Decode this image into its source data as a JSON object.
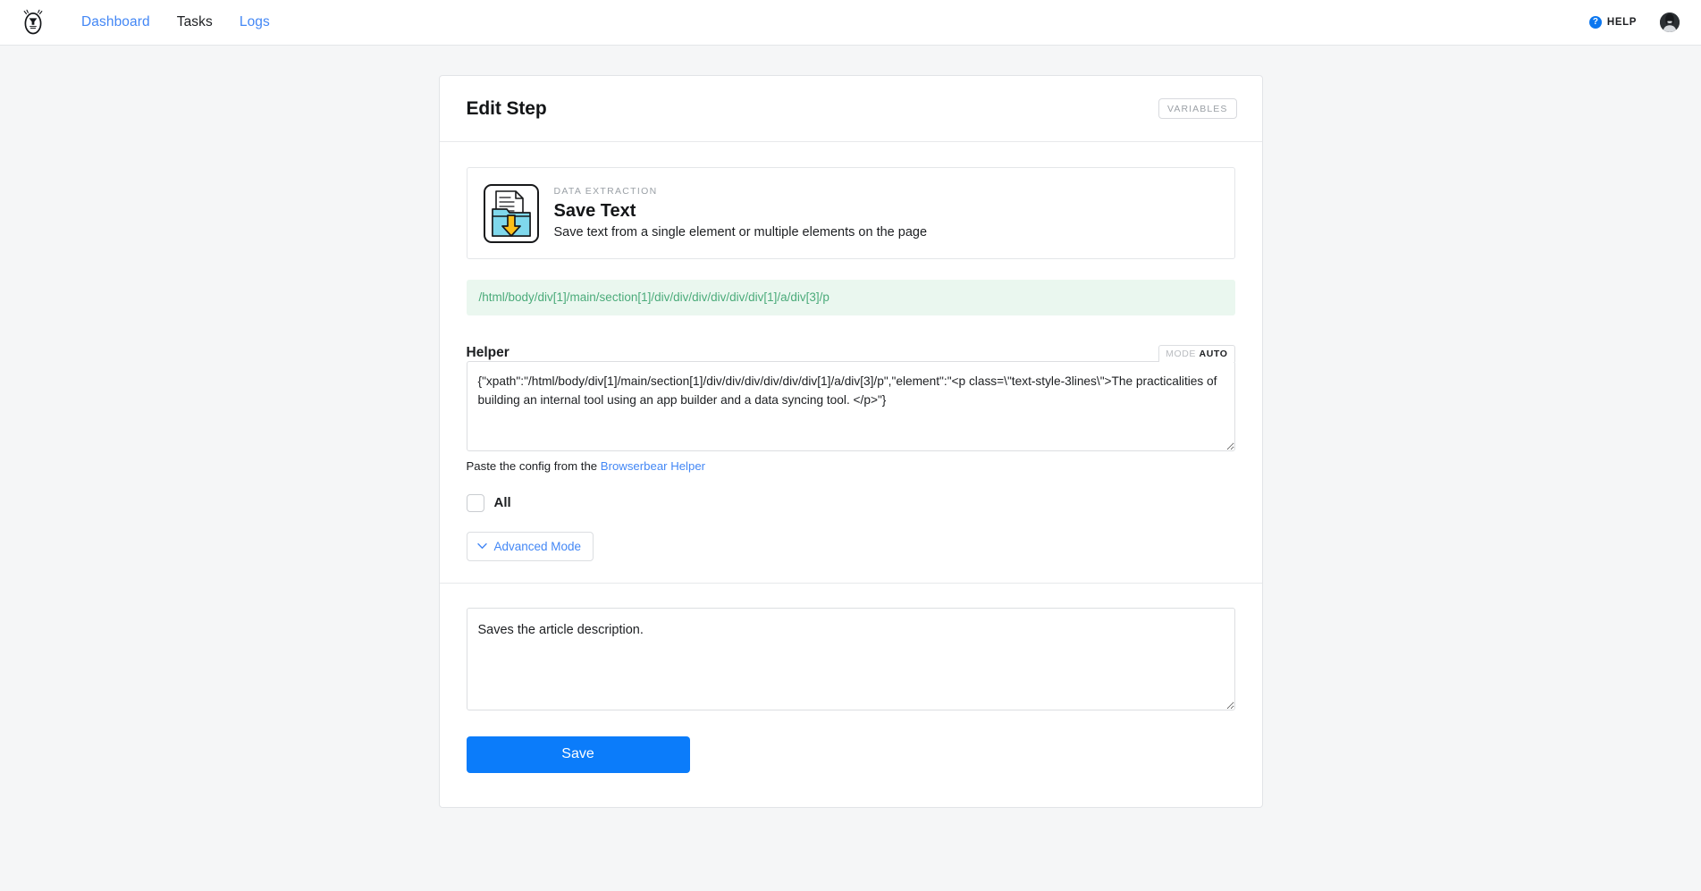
{
  "navbar": {
    "brand_icon": "bear-logo-icon",
    "links": [
      {
        "label": "Dashboard",
        "active": false
      },
      {
        "label": "Tasks",
        "active": true
      },
      {
        "label": "Logs",
        "active": false
      }
    ],
    "help": {
      "icon": "question-mark-circle-icon",
      "glyph": "?",
      "label": "HELP"
    },
    "avatar": {
      "icon": "user-avatar-icon"
    }
  },
  "card": {
    "title": "Edit Step",
    "variables_button": "VARIABLES",
    "action": {
      "icon": "save-text-folder-download-icon",
      "kicker": "DATA EXTRACTION",
      "title": "Save Text",
      "description": "Save text from a single element or multiple elements on the page"
    },
    "xpath": "/html/body/div[1]/main/section[1]/div/div/div/div/div/div[1]/a/div[3]/p",
    "helper": {
      "label": "Helper",
      "mode_key": "MODE",
      "mode_value": "AUTO",
      "value": "{\"xpath\":\"/html/body/div[1]/main/section[1]/div/div/div/div/div/div[1]/a/div[3]/p\",\"element\":\"<p class=\\\"text-style-3lines\\\">The practicalities of building an internal tool using an app builder and a data syncing tool. </p>\"}",
      "placeholder": "",
      "hint_text": "Paste the config from the",
      "hint_link": "Browserbear Helper"
    },
    "all_checkbox": {
      "label": "All",
      "checked": false
    },
    "advanced_mode": {
      "label": "Advanced Mode",
      "icon": "chevron-down-icon"
    },
    "description": {
      "value": "Saves the article description.",
      "placeholder": ""
    },
    "save_button": "Save"
  },
  "colors": {
    "accent_blue": "#0b7cfa",
    "link_blue": "#4387f5",
    "xpath_green_text": "#4bab7a",
    "xpath_green_bg": "#eaf7ef",
    "page_bg": "#f5f6f7",
    "icon_cyan": "#7fd8ec",
    "icon_yellow": "#fcbf19"
  }
}
